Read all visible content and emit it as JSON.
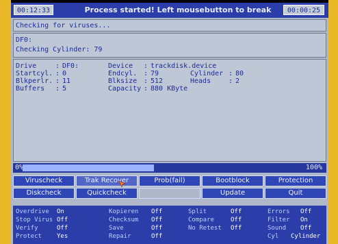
{
  "titlebar": {
    "left_box": "00:12:33",
    "message": "Process started! Left mousebutton to break",
    "right_box": "00:00:25"
  },
  "status_line": "Checking for viruses...",
  "drive_panel": {
    "line1": "DF0:",
    "line2": "Checking Cylinder: 79"
  },
  "info": {
    "col1": [
      {
        "label": "Drive",
        "value": "DF0:"
      },
      {
        "label": "Startcyl.",
        "value": "0"
      },
      {
        "label": "Blkperlr.",
        "value": "11"
      },
      {
        "label": "Buffers",
        "value": "5"
      }
    ],
    "col2": [
      {
        "label": "Device",
        "value": "trackdisk.device"
      },
      {
        "label": "Endcyl.",
        "value": "79"
      },
      {
        "label": "Blksize",
        "value": "512"
      },
      {
        "label": "Capacity",
        "value": "880 KByte"
      }
    ],
    "col3": [
      {
        "label": "Cylinder",
        "value": "80"
      },
      {
        "label": "Heads",
        "value": "2"
      }
    ]
  },
  "progress": {
    "left_label": "0%",
    "right_label": "100%",
    "fraction": 0.48
  },
  "buttons_row1": [
    "Viruscheck",
    "Trak Recover",
    "Prob(fail)",
    "Bootblock",
    "Protection"
  ],
  "buttons_row2": [
    "Diskcheck",
    "Quickcheck",
    "",
    "Update",
    "Quit"
  ],
  "options": [
    {
      "label": "Overdrive",
      "value": "On"
    },
    {
      "label": "Stop Virus",
      "value": "Off"
    },
    {
      "label": "Verify",
      "value": "Off"
    },
    {
      "label": "Protect",
      "value": "Yes"
    },
    {
      "label": "Kopieren",
      "value": "Off"
    },
    {
      "label": "Checksum",
      "value": "Off"
    },
    {
      "label": "Save",
      "value": "Off"
    },
    {
      "label": "Repair",
      "value": "Off"
    },
    {
      "label": "Split",
      "value": "Off"
    },
    {
      "label": "Compare",
      "value": "Off"
    },
    {
      "label": "No Retest",
      "value": "Off"
    },
    {
      "label": "Errors",
      "value": "Off"
    },
    {
      "label": "Filter",
      "value": "On"
    },
    {
      "label": "Sound",
      "value": "Off"
    },
    {
      "label": "Cyl",
      "value": "Cylinder"
    }
  ],
  "colors": {
    "frame": "#e8b826",
    "titlebar": "#2a3da8",
    "panel": "#bec7d6",
    "text": "#1c2a96"
  }
}
